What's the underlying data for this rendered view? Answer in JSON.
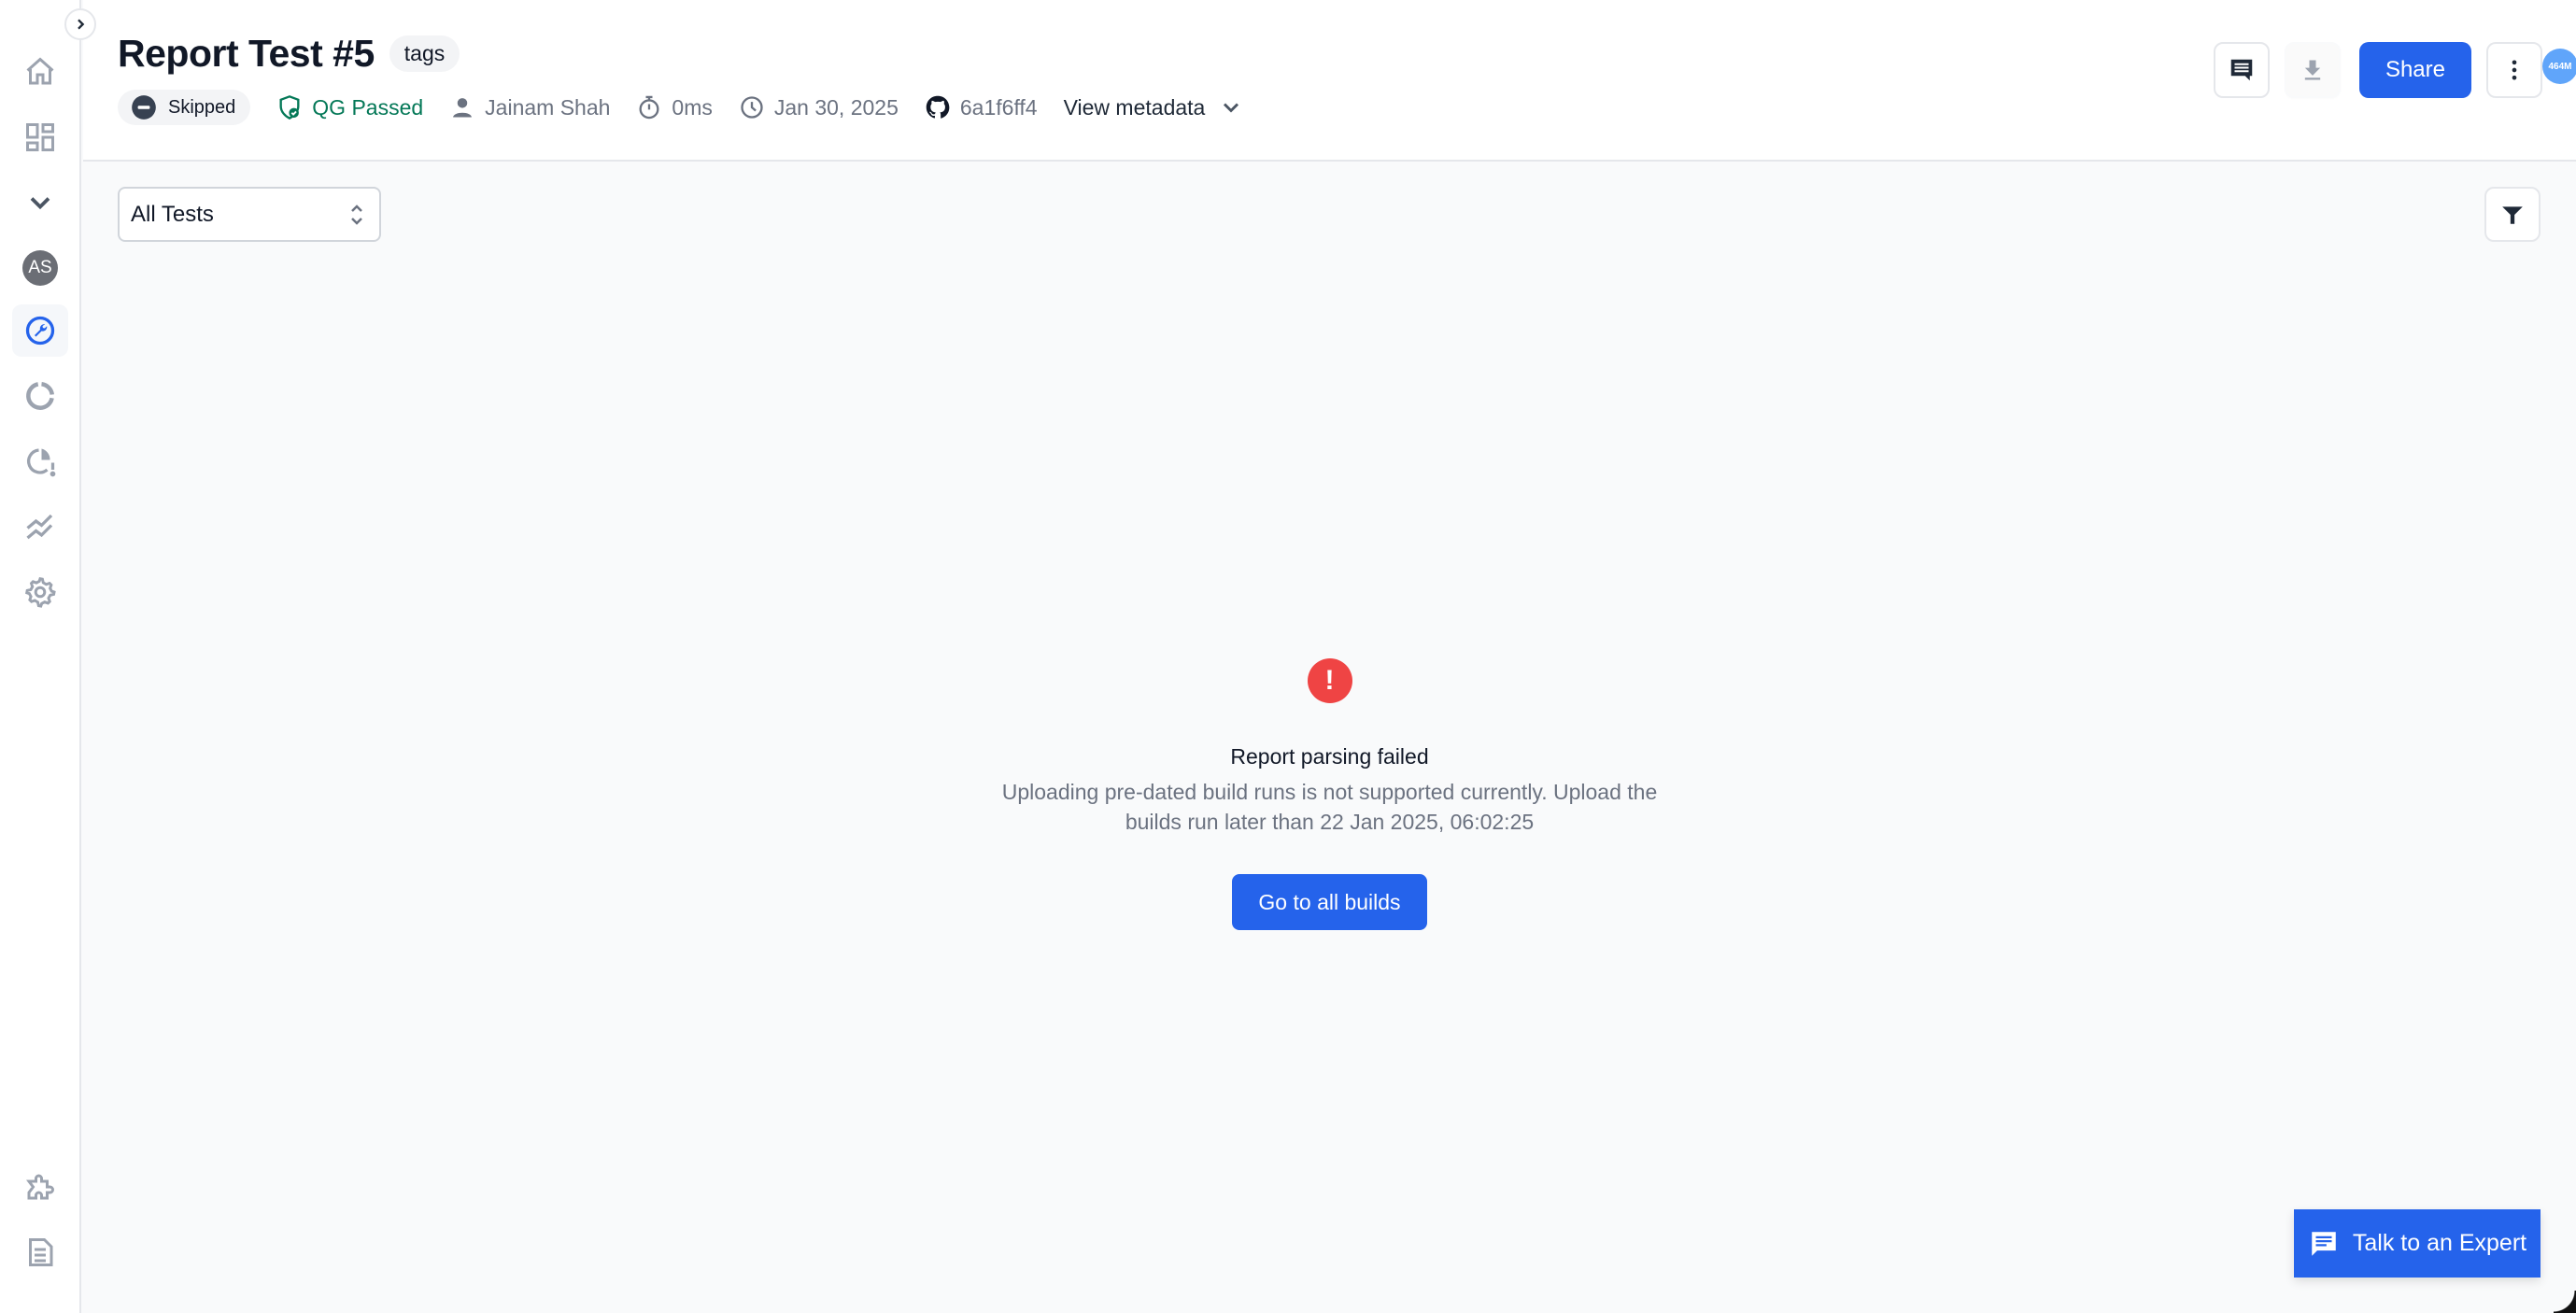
{
  "sidebar": {
    "toggle_icon": "chevron-right-icon",
    "items": [
      {
        "name": "home",
        "icon": "home-icon"
      },
      {
        "name": "dashboard",
        "icon": "dashboard-icon"
      },
      {
        "name": "expand",
        "icon": "chevron-down-icon"
      },
      {
        "name": "user",
        "icon": "avatar",
        "initials": "AS"
      },
      {
        "name": "test-reporting",
        "icon": "wrench-icon",
        "active": true
      },
      {
        "name": "builds",
        "icon": "loading-circle-icon"
      },
      {
        "name": "alerts",
        "icon": "pie-alert-icon"
      },
      {
        "name": "trends",
        "icon": "trend-icon"
      },
      {
        "name": "settings",
        "icon": "gear-icon"
      }
    ],
    "bottom_items": [
      {
        "name": "integrations",
        "icon": "puzzle-icon"
      },
      {
        "name": "docs",
        "icon": "document-icon"
      }
    ]
  },
  "header": {
    "title": "Report Test #5",
    "tag_label": "tags",
    "status": "Skipped",
    "quality_gate": "QG Passed",
    "user": "Jainam Shah",
    "duration": "0ms",
    "date": "Jan 30, 2025",
    "commit": "6a1f6ff4",
    "view_metadata_label": "View metadata",
    "share_label": "Share",
    "memory_badge": "464M"
  },
  "toolbar": {
    "filter_select_value": "All Tests"
  },
  "empty_state": {
    "title": "Report parsing failed",
    "description": "Uploading pre-dated build runs is not supported currently. Upload the builds run later than 22 Jan 2025, 06:02:25",
    "button_label": "Go to all builds"
  },
  "support": {
    "label": "Talk to an Expert"
  },
  "colors": {
    "primary": "#2563eb",
    "success": "#047857",
    "error": "#ef4444",
    "badge": "#60a5fa"
  }
}
